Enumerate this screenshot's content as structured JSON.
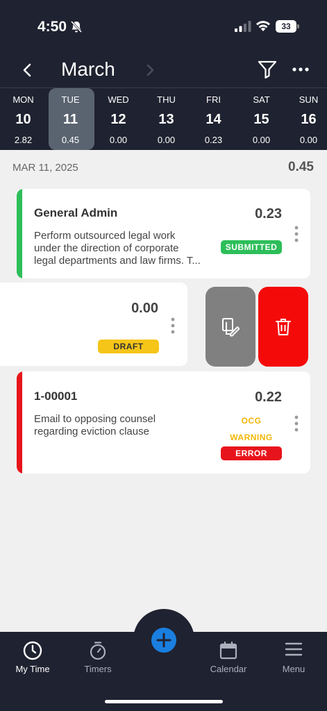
{
  "status": {
    "time": "4:50",
    "battery": "33"
  },
  "header": {
    "month": "March"
  },
  "week": [
    {
      "name": "MON",
      "date": "10",
      "value": "2.82",
      "selected": false
    },
    {
      "name": "TUE",
      "date": "11",
      "value": "0.45",
      "selected": true
    },
    {
      "name": "WED",
      "date": "12",
      "value": "0.00",
      "selected": false
    },
    {
      "name": "THU",
      "date": "13",
      "value": "0.00",
      "selected": false
    },
    {
      "name": "FRI",
      "date": "14",
      "value": "0.23",
      "selected": false
    },
    {
      "name": "SAT",
      "date": "15",
      "value": "0.00",
      "selected": false
    },
    {
      "name": "SUN",
      "date": "16",
      "value": "0.00",
      "selected": false
    }
  ],
  "day_summary": {
    "date_label": "MAR 11, 2025",
    "total": "0.45"
  },
  "entries": [
    {
      "title": "General Admin",
      "amount": "0.23",
      "description_line1": "Perform outsourced legal work",
      "description_line2": "under the direction of corporate",
      "description_line3": "legal departments and law firms. T...",
      "status": "SUBMITTED",
      "status_color": "#2dbe5a"
    },
    {
      "title": "",
      "amount": "0.00",
      "status": "DRAFT",
      "status_color": "#f5c518"
    },
    {
      "title": "1-00001",
      "amount": "0.22",
      "description_line1": "Email to opposing counsel",
      "description_line2": "regarding eviction clause",
      "flag1": "OCG",
      "flag2": "WARNING",
      "status": "ERROR",
      "status_color": "#e8141b"
    }
  ],
  "swipe_actions": {
    "copy_color": "#808080",
    "delete_color": "#f50a0a"
  },
  "tabs": [
    {
      "label": "My Time",
      "icon": "clock-icon",
      "active": true
    },
    {
      "label": "Timers",
      "icon": "stopwatch-icon",
      "active": false
    },
    {
      "label": "Calendar",
      "icon": "calendar-icon",
      "active": false
    },
    {
      "label": "Menu",
      "icon": "menu-icon",
      "active": false
    }
  ]
}
